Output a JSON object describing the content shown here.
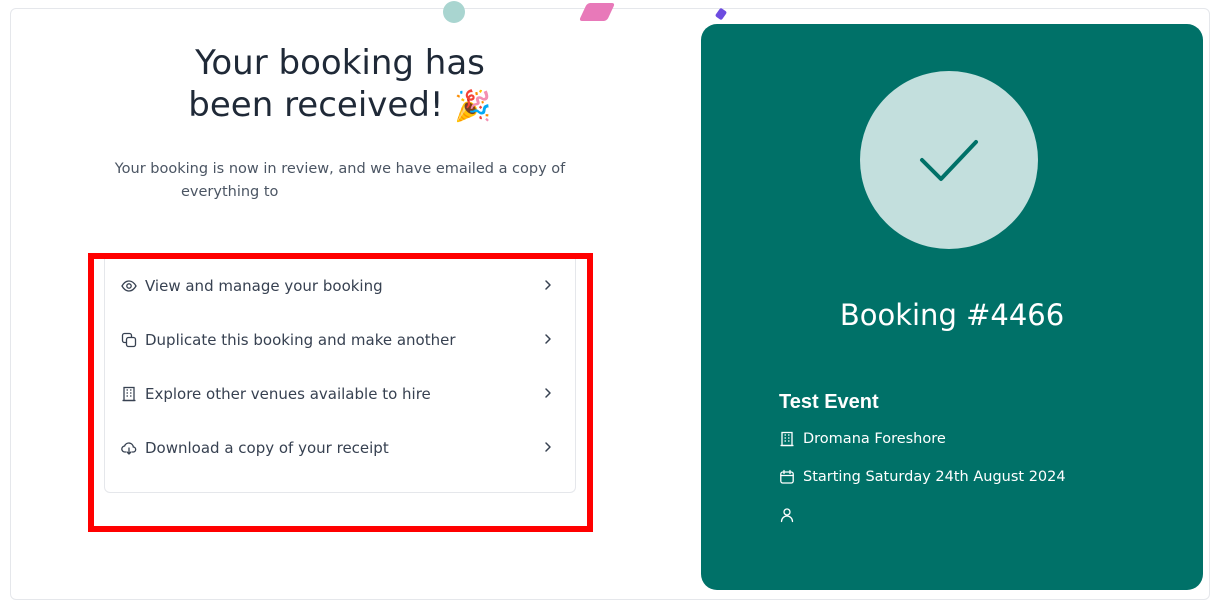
{
  "confirmation": {
    "title_line1": "Your booking has",
    "title_line2": "been received!",
    "title_emoji": "🎉",
    "subtitle_line1": "Your booking is now in review, and we have emailed a copy of",
    "subtitle_line2": "everything to"
  },
  "actions": [
    {
      "label": "View and manage your booking",
      "icon": "eye-icon"
    },
    {
      "label": "Duplicate this booking and make another",
      "icon": "copy-icon"
    },
    {
      "label": "Explore other venues available to hire",
      "icon": "building-icon"
    },
    {
      "label": "Download a copy of your receipt",
      "icon": "cloud-download-icon"
    }
  ],
  "booking_panel": {
    "booking_number": "Booking #4466",
    "event_name": "Test Event",
    "venue": "Dromana Foreshore",
    "start": "Starting Saturday 24th August 2024",
    "person": ""
  },
  "colors": {
    "panel_bg": "#007168",
    "check_circle": "#c3dfdd",
    "annotation": "#ff0000"
  }
}
